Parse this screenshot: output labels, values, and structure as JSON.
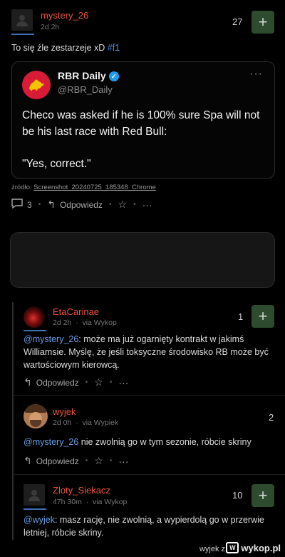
{
  "post": {
    "author": "mystery_26",
    "time": "2d 2h",
    "votes": "27",
    "plus": "+",
    "text": "To się źle zestarzeje xD ",
    "tag": "#f1",
    "embed": {
      "name": "RBR Daily",
      "verified": "✓",
      "handle": "@RBR_Daily",
      "more": "···",
      "line1": "Checo was asked if he is 100% sure Spa will not be his last race with Red Bull:",
      "line2": "\"Yes, correct.\""
    },
    "source_label": "źródło: ",
    "source_link": "Screenshot_20240725_185348_Chrome",
    "comments_count": "3",
    "reply_label": "Odpowiedz",
    "more": "···"
  },
  "comments": [
    {
      "author": "EtaCarinae",
      "time": "2d 2h",
      "via": "via Wykop",
      "votes": "1",
      "plus": "+",
      "mention": "@mystery_26",
      "text": ": może ma już ogarnięty kontrakt w jakimś Williamsie. Myślę, że jeśli toksyczne środowisko RB może być wartościowym kierowcą.",
      "reply_label": "Odpowiedz"
    },
    {
      "author": "wyjek",
      "time": "2d 0h",
      "via": "via Wypiek",
      "votes": "2",
      "mention": "@mystery_26",
      "text": " nie zwolnią go w tym sezonie, róbcie skriny",
      "reply_label": "Odpowiedz"
    },
    {
      "author": "Zloty_Siekacz",
      "time": "47h 30m",
      "via": "via Wykop",
      "votes": "10",
      "plus": "+",
      "mention": "@wyjek",
      "text": ": masz rację, nie zwolnią, a wypierdolą go w przerwie letniej, róbcie skriny."
    }
  ],
  "footer": {
    "text": "wyjek z",
    "logo": "wykop.pl"
  },
  "colors": {
    "nick": "#e8523f",
    "link": "#4a90e2",
    "plus_bg": "#2e4a2f"
  }
}
